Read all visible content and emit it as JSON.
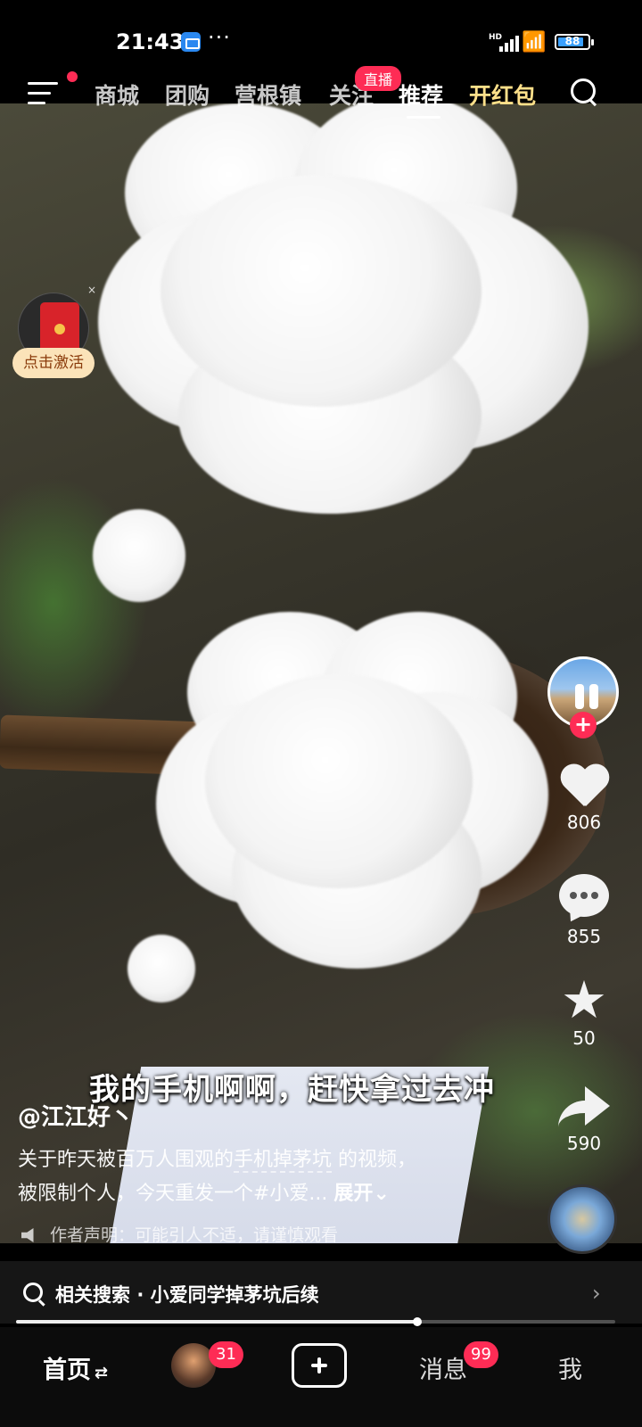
{
  "status_bar": {
    "time": "21:43",
    "network": "HD",
    "battery": "88",
    "battery_percent": 88,
    "icons": [
      "app-notification-icon",
      "more-dots-icon",
      "signal-icon",
      "wifi-icon",
      "battery-icon"
    ]
  },
  "top_nav": {
    "tabs": [
      "商城",
      "团购",
      "营根镇",
      "关注",
      "推荐",
      "开红包"
    ],
    "active_tab": "推荐",
    "live_badge": "直播",
    "icons": [
      "menu-icon",
      "search-icon"
    ],
    "colors": {
      "highlight_tab": "#ffe08a",
      "badge": "#fe2c55"
    }
  },
  "red_packet": {
    "label": "点击激活",
    "close": "×"
  },
  "video": {
    "overlay_caption": "我的手机啊啊，赶快拿过去冲"
  },
  "right_rail": {
    "follow": "+",
    "likes": "806",
    "comments": "855",
    "favorites": "50",
    "shares": "590",
    "icons": [
      "author-avatar",
      "heart-icon",
      "comment-icon",
      "star-icon",
      "share-icon",
      "music-disc"
    ]
  },
  "caption": {
    "author": "@江江好丶",
    "desc_prefix": "关于昨天被百万人围观的",
    "desc_link": "手机掉茅坑",
    "desc_suffix": " 的视频，",
    "desc_line2": "被限制个人，今天重发一个#小爱...",
    "expand": "展开",
    "disclaimer": "作者声明：可能引人不适，请谨慎观看"
  },
  "related_search": {
    "prefix": "相关搜索",
    "separator": "·",
    "query": "小爱同学掉茅坑后续"
  },
  "progress": {
    "fraction": 0.67
  },
  "bottom_tabs": {
    "home": "首页",
    "home_swap": "⇄",
    "friends_badge": "31",
    "messages": "消息",
    "messages_badge": "99",
    "me": "我"
  }
}
